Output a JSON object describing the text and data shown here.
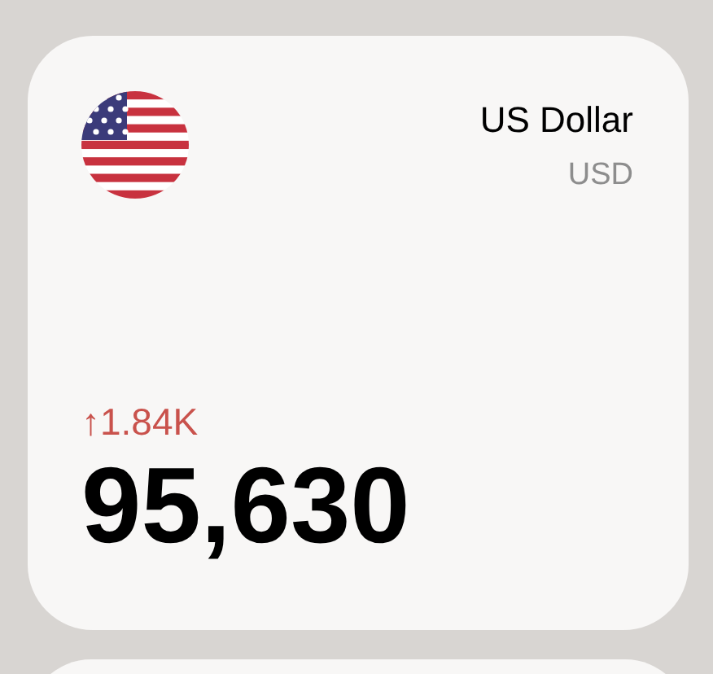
{
  "cards": [
    {
      "name": "US Dollar",
      "code": "USD",
      "change": "↑1.84K",
      "value": "95,630"
    }
  ],
  "next_card": {
    "kind": "card"
  }
}
